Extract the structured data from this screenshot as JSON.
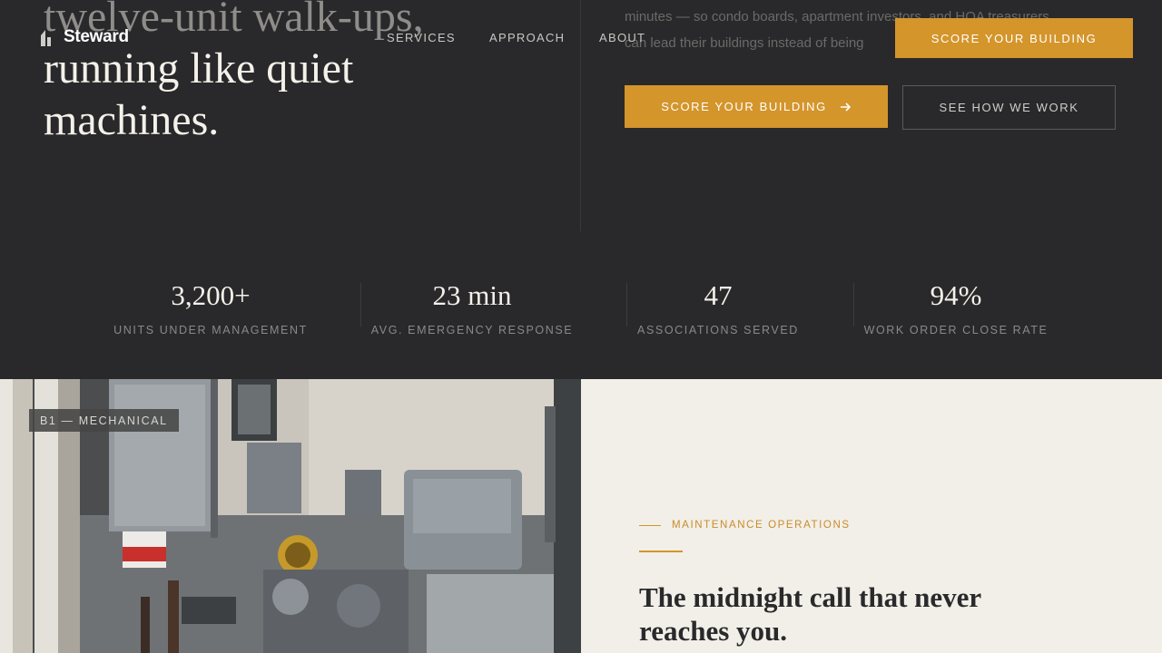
{
  "nav": {
    "brand": "Steward",
    "links": [
      "Services",
      "Approach",
      "About"
    ],
    "cta": "Score your building"
  },
  "hero": {
    "headline_lines": [
      "twelve-unit walk-ups,",
      "running like quiet",
      "machines."
    ],
    "body_lines": [
      "minutes — so condo boards, apartment investors, and HOA treasurers",
      "can lead their buildings instead of being"
    ],
    "primary_cta": "Score your building",
    "secondary_cta": "See how we work"
  },
  "stats": [
    {
      "value": "3,200+",
      "label": "Units under management"
    },
    {
      "value": "23 min",
      "label": "Avg. emergency response"
    },
    {
      "value": "47",
      "label": "Associations served"
    },
    {
      "value": "94%",
      "label": "Work order close rate"
    }
  ],
  "photo": {
    "tag": "B1 — Mechanical"
  },
  "section": {
    "eyebrow": "Maintenance operations",
    "title": "The midnight call that never reaches you."
  },
  "colors": {
    "accent": "#d4952b",
    "dark": "#29292b",
    "cream": "#f2efe8"
  }
}
